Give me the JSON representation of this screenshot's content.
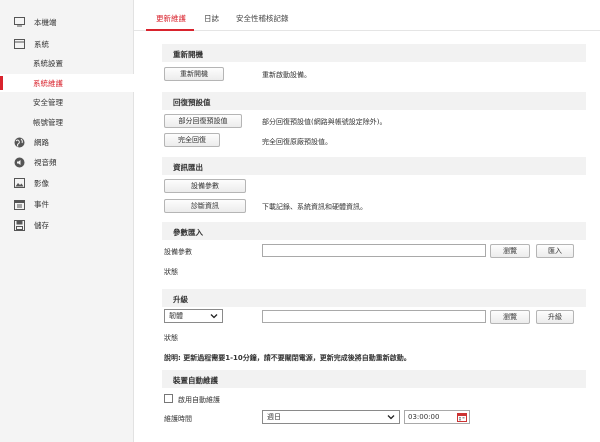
{
  "sidebar": {
    "items": [
      {
        "label": "本機端",
        "icon": "monitor-icon"
      },
      {
        "label": "系統",
        "icon": "window-icon"
      },
      {
        "label": "系統設置"
      },
      {
        "label": "系統維護"
      },
      {
        "label": "安全管理"
      },
      {
        "label": "帳號管理"
      },
      {
        "label": "網路",
        "icon": "globe-icon"
      },
      {
        "label": "視音頻",
        "icon": "speaker-icon"
      },
      {
        "label": "影像",
        "icon": "image-icon"
      },
      {
        "label": "事件",
        "icon": "calendar-icon"
      },
      {
        "label": "儲存",
        "icon": "storage-icon"
      }
    ]
  },
  "tabs": [
    "更新維護",
    "日誌",
    "安全性稽核記錄"
  ],
  "reboot": {
    "title": "重新開機",
    "button": "重新開機",
    "desc": "重新啟動設備。"
  },
  "restore": {
    "title": "回復預設值",
    "partial_button": "部分回復預設值",
    "partial_desc": "部分回復預設值(網路與帳號設定除外)。",
    "full_button": "完全回復",
    "full_desc": "完全回復原廠預設值。"
  },
  "export": {
    "title": "資訊匯出",
    "params_button": "設備參數",
    "diag_button": "診斷資訊",
    "diag_desc": "下載記錄、系統資訊和硬體資訊。"
  },
  "import": {
    "title": "參數匯入",
    "field_label": "設備參數",
    "browse_button": "瀏覽",
    "import_button": "匯入",
    "status_label": "狀態"
  },
  "upgrade": {
    "title": "升級",
    "select_value": "韌體",
    "browse_button": "瀏覽",
    "upgrade_button": "升級",
    "status_label": "狀態"
  },
  "note": "說明: 更新過程需要1-10分鐘，請不要關閉電源，更新完成後將自動重新啟動。",
  "auto_maint": {
    "title": "裝置自動維護",
    "enable_label": "啟用自動維護",
    "time_label": "維護時間",
    "day_value": "週日",
    "time_value": "03:00:00"
  },
  "colors": {
    "accent": "#d9232d",
    "section_bg": "#f2f2f2",
    "sidebar_bg": "#f4f4f4"
  }
}
